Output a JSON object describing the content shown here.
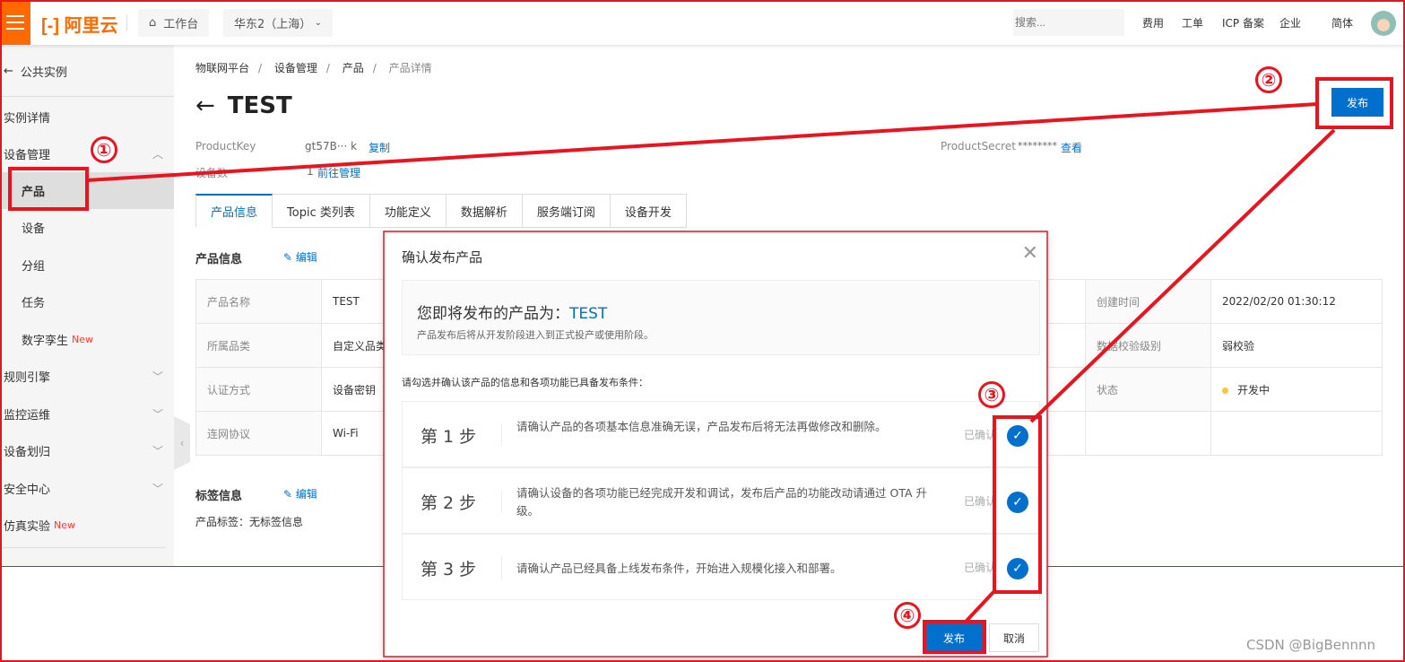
{
  "header": {
    "logo": "阿里云",
    "workbench": "工作台",
    "region": "华东2（上海）",
    "search_placeholder": "搜索...",
    "links": [
      "费用",
      "工单",
      "ICP 备案",
      "企业",
      "简体"
    ]
  },
  "sidebar": {
    "back": "公共实例",
    "items": [
      {
        "label": "实例详情",
        "level": "top"
      },
      {
        "label": "设备管理",
        "level": "top",
        "chevron": "up"
      },
      {
        "label": "产品",
        "level": "sub",
        "active": true
      },
      {
        "label": "设备",
        "level": "sub"
      },
      {
        "label": "分组",
        "level": "sub"
      },
      {
        "label": "任务",
        "level": "sub"
      },
      {
        "label": "数字孪生",
        "level": "sub",
        "badge": "New"
      },
      {
        "label": "规则引擎",
        "level": "top",
        "chevron": "down"
      },
      {
        "label": "监控运维",
        "level": "top",
        "chevron": "down"
      },
      {
        "label": "设备划归",
        "level": "top",
        "chevron": "down"
      },
      {
        "label": "安全中心",
        "level": "top",
        "chevron": "down"
      },
      {
        "label": "仿真实验",
        "level": "top",
        "badge": "New"
      }
    ]
  },
  "breadcrumb": [
    "物联网平台",
    "设备管理",
    "产品",
    "产品详情"
  ],
  "page": {
    "title": "TEST",
    "publish": "发布",
    "product_key_label": "ProductKey",
    "product_key_value": "gt57B··· k",
    "copy": "复制",
    "device_count_label": "设备数",
    "device_count_value": "1",
    "manage": "前往管理",
    "secret_label": "ProductSecret",
    "secret_value": "********",
    "view": "查看"
  },
  "tabs": [
    "产品信息",
    "Topic 类列表",
    "功能定义",
    "数据解析",
    "服务端订阅",
    "设备开发"
  ],
  "product_info": {
    "title": "产品信息",
    "edit": "编辑",
    "left": [
      [
        "产品名称",
        "TEST"
      ],
      [
        "所属品类",
        "自定义品类"
      ],
      [
        "认证方式",
        "设备密钥"
      ],
      [
        "连网协议",
        "Wi-Fi"
      ]
    ],
    "right": [
      [
        "创建时间",
        "2022/02/20 01:30:12"
      ],
      [
        "数据校验级别",
        "弱校验"
      ],
      [
        "状态",
        "开发中"
      ]
    ],
    "status_color": "#ffc440"
  },
  "tag_info": {
    "title": "标签信息",
    "edit": "编辑",
    "label": "产品标签：",
    "value": "无标签信息"
  },
  "modal": {
    "title": "确认发布产品",
    "product_prefix": "您即将发布的产品为：",
    "product_name": "TEST",
    "desc": "产品发布后将从开发阶段进入到正式投产或使用阶段。",
    "hint": "请勾选并确认该产品的信息和各项功能已具备发布条件：",
    "steps": [
      {
        "n": "第 1 步",
        "text": "请确认产品的各项基本信息准确无误，产品发布后将无法再做修改和删除。",
        "ok": "已确认",
        "checked": true
      },
      {
        "n": "第 2 步",
        "text": "请确认设备的各项功能已经完成开发和调试，发布后产品的功能改动请通过 OTA 升级。",
        "ok": "已确认",
        "checked": true
      },
      {
        "n": "第 3 步",
        "text": "请确认产品已经具备上线发布条件，开始进入规模化接入和部署。",
        "ok": "已确认",
        "checked": true
      }
    ],
    "publish": "发布",
    "cancel": "取消"
  },
  "annotations": [
    "①",
    "②",
    "③",
    "④"
  ],
  "watermark": "CSDN @BigBennnn",
  "colors": {
    "brand": "#ff6a00",
    "primary": "#0070cc",
    "annotation": "#e8141f",
    "new_badge": "#ff3b30"
  }
}
